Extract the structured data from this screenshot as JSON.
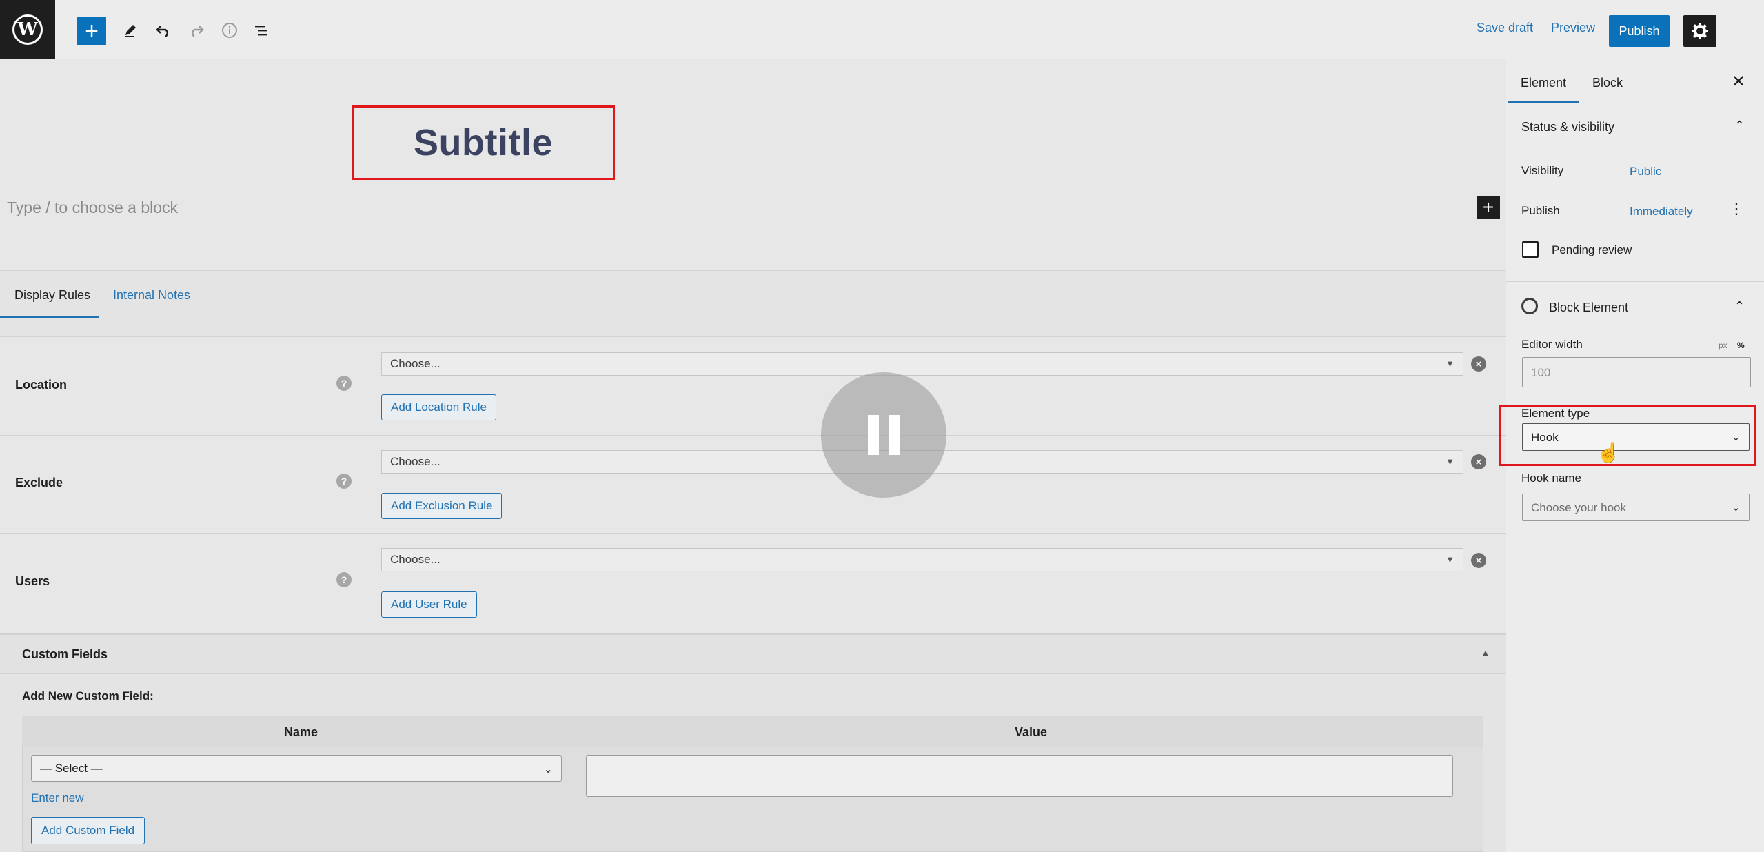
{
  "toolbar": {
    "wp_logo": "W",
    "add_icon": "+",
    "edit_icon": "pencil-icon",
    "undo_icon": "undo-icon",
    "redo_icon": "redo-icon",
    "info_icon": "info-icon",
    "list_icon": "list-view-icon",
    "save_draft": "Save draft",
    "preview": "Preview",
    "publish": "Publish",
    "settings_icon": "gear-icon"
  },
  "canvas": {
    "subtitle": "Subtitle",
    "block_placeholder": "Type / to choose a block",
    "add_block": "+"
  },
  "metabox": {
    "tabs": [
      {
        "label": "Display Rules"
      },
      {
        "label": "Internal Notes"
      }
    ],
    "rules": [
      {
        "label": "Location",
        "select_value": "Choose...",
        "button": "Add Location Rule"
      },
      {
        "label": "Exclude",
        "select_value": "Choose...",
        "button": "Add Exclusion Rule"
      },
      {
        "label": "Users",
        "select_value": "Choose...",
        "button": "Add User Rule"
      }
    ],
    "help_glyph": "?",
    "remove_glyph": "×",
    "custom_fields": {
      "title": "Custom Fields",
      "add_new_label": "Add New Custom Field:",
      "col_name": "Name",
      "col_value": "Value",
      "select_value": "— Select —",
      "enter_new": "Enter new",
      "add_button": "Add Custom Field"
    }
  },
  "sidebar": {
    "tabs": [
      {
        "label": "Element"
      },
      {
        "label": "Block"
      }
    ],
    "close_glyph": "✕",
    "status": {
      "title": "Status & visibility",
      "visibility_label": "Visibility",
      "visibility_value": "Public",
      "publish_label": "Publish",
      "publish_value": "Immediately",
      "pending_label": "Pending review"
    },
    "block_element": {
      "title": "Block Element",
      "editor_width_label": "Editor width",
      "unit_px": "px",
      "unit_pct": "%",
      "editor_width_placeholder": "100",
      "element_type_label": "Element type",
      "element_type_value": "Hook",
      "hook_name_label": "Hook name",
      "hook_name_value": "Choose your hook"
    }
  },
  "colors": {
    "accent": "#2271b1",
    "highlight": "#e0161b",
    "dark": "#1e1e1e"
  }
}
